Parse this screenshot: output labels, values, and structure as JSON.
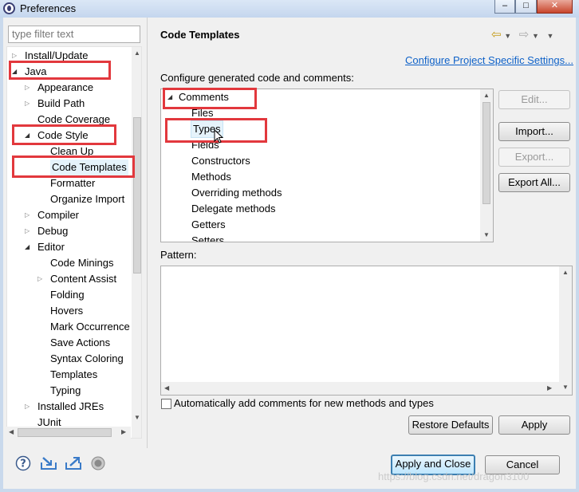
{
  "window": {
    "title": "Preferences",
    "minimize_glyph": "–",
    "maximize_glyph": "□",
    "close_glyph": "✕"
  },
  "left": {
    "filter_placeholder": "type filter text",
    "tree": [
      {
        "label": "Install/Update",
        "level": 0,
        "arrow": "collapsed"
      },
      {
        "label": "Java",
        "level": 0,
        "arrow": "expanded"
      },
      {
        "label": "Appearance",
        "level": 1,
        "arrow": "collapsed"
      },
      {
        "label": "Build Path",
        "level": 1,
        "arrow": "collapsed"
      },
      {
        "label": "Code Coverage",
        "level": 1,
        "arrow": "none"
      },
      {
        "label": "Code Style",
        "level": 1,
        "arrow": "expanded"
      },
      {
        "label": "Clean Up",
        "level": 2,
        "arrow": "none"
      },
      {
        "label": "Code Templates",
        "level": 2,
        "arrow": "none",
        "selected": true
      },
      {
        "label": "Formatter",
        "level": 2,
        "arrow": "none"
      },
      {
        "label": "Organize Import",
        "level": 2,
        "arrow": "none"
      },
      {
        "label": "Compiler",
        "level": 1,
        "arrow": "collapsed"
      },
      {
        "label": "Debug",
        "level": 1,
        "arrow": "collapsed"
      },
      {
        "label": "Editor",
        "level": 1,
        "arrow": "expanded"
      },
      {
        "label": "Code Minings",
        "level": 2,
        "arrow": "none"
      },
      {
        "label": "Content Assist",
        "level": 2,
        "arrow": "collapsed"
      },
      {
        "label": "Folding",
        "level": 2,
        "arrow": "none"
      },
      {
        "label": "Hovers",
        "level": 2,
        "arrow": "none"
      },
      {
        "label": "Mark Occurrence",
        "level": 2,
        "arrow": "none"
      },
      {
        "label": "Save Actions",
        "level": 2,
        "arrow": "none"
      },
      {
        "label": "Syntax Coloring",
        "level": 2,
        "arrow": "none"
      },
      {
        "label": "Templates",
        "level": 2,
        "arrow": "none"
      },
      {
        "label": "Typing",
        "level": 2,
        "arrow": "none"
      },
      {
        "label": "Installed JREs",
        "level": 1,
        "arrow": "collapsed"
      },
      {
        "label": "JUnit",
        "level": 1,
        "arrow": "none"
      }
    ]
  },
  "right": {
    "title": "Code Templates",
    "configure_link": "Configure Project Specific Settings...",
    "description": "Configure generated code and comments:",
    "templates": [
      {
        "label": "Comments",
        "level": 0,
        "arrow": "expanded"
      },
      {
        "label": "Files",
        "level": 1
      },
      {
        "label": "Types",
        "level": 1,
        "hover": true
      },
      {
        "label": "Fields",
        "level": 1
      },
      {
        "label": "Constructors",
        "level": 1
      },
      {
        "label": "Methods",
        "level": 1
      },
      {
        "label": "Overriding methods",
        "level": 1
      },
      {
        "label": "Delegate methods",
        "level": 1
      },
      {
        "label": "Getters",
        "level": 1
      },
      {
        "label": "Setters",
        "level": 1
      }
    ],
    "buttons": {
      "edit": "Edit...",
      "import": "Import...",
      "export": "Export...",
      "export_all": "Export All..."
    },
    "pattern_label": "Pattern:",
    "auto_comment_label": "Automatically add comments for new methods and types",
    "auto_comment_checked": false,
    "restore_defaults": "Restore Defaults",
    "apply": "Apply"
  },
  "footer": {
    "apply_and_close": "Apply and Close",
    "cancel": "Cancel",
    "icons": [
      "help-icon",
      "import-prefs-icon",
      "export-prefs-icon",
      "oomph-record-icon"
    ]
  },
  "watermark": "https://blog.csdn.net/dragon3100"
}
